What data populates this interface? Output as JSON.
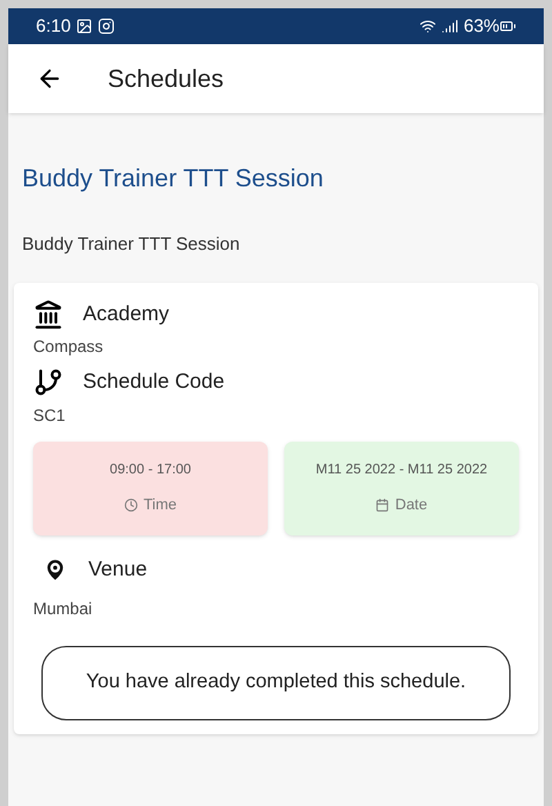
{
  "status_bar": {
    "time": "6:10",
    "battery": "63%"
  },
  "app_bar": {
    "title": "Schedules"
  },
  "session": {
    "title": "Buddy Trainer TTT Session",
    "description": "Buddy Trainer TTT Session"
  },
  "details": [
    {
      "kind": "academy",
      "label": "Academy",
      "value": "Compass"
    },
    {
      "kind": "code",
      "label": "Schedule Code",
      "value": "SC1"
    }
  ],
  "tiles": [
    {
      "kind": "time",
      "value": "09:00 - 17:00",
      "label": "Time",
      "color": "#fbe0e0"
    },
    {
      "kind": "date",
      "value": "M11 25 2022 - M11 25 2022",
      "label": "Date",
      "color": "#e3f7e3"
    }
  ],
  "venue": {
    "label": "Venue",
    "value": "Mumbai"
  },
  "notice": "You have already completed this schedule."
}
